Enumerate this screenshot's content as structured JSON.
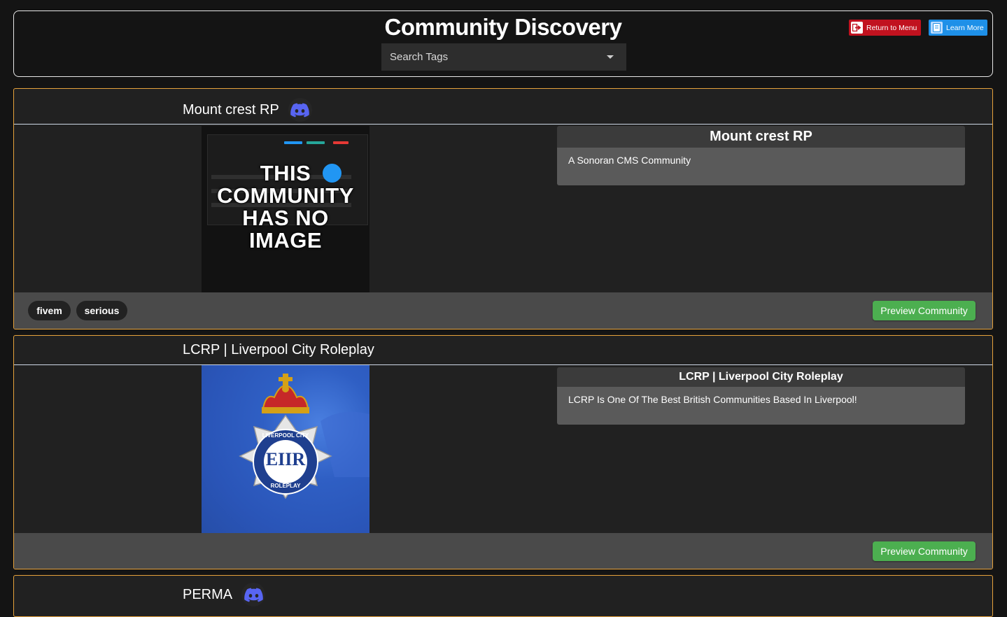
{
  "header": {
    "title": "Community Discovery",
    "search_placeholder": "Search Tags",
    "return_label": "Return to Menu",
    "learn_label": "Learn More"
  },
  "colors": {
    "card_border": "#e6a23c",
    "return_button": "#c1121f",
    "learn_button": "#1e90e8",
    "preview_button": "#4caf50",
    "discord": "#5865f2"
  },
  "communities": [
    {
      "name": "Mount crest RP",
      "has_discord": true,
      "image": "no-image-placeholder",
      "image_text": "THIS COMMUNITY HAS NO IMAGE",
      "description_title": "Mount crest RP",
      "description": "A Sonoran CMS Community",
      "tags": [
        "fivem",
        "serious"
      ],
      "preview_label": "Preview Community"
    },
    {
      "name": "LCRP | Liverpool City Roleplay",
      "has_discord": false,
      "image": "police-crest-logo",
      "logo_text": [
        "LIVERPOOL CITY",
        "ROLEPLAY",
        "EIIR"
      ],
      "description_title": "LCRP | Liverpool City Roleplay",
      "description": "LCRP Is One Of The Best British Communities Based In Liverpool!",
      "tags": [],
      "preview_label": "Preview Community"
    },
    {
      "name": "PERMA",
      "has_discord": true
    }
  ]
}
